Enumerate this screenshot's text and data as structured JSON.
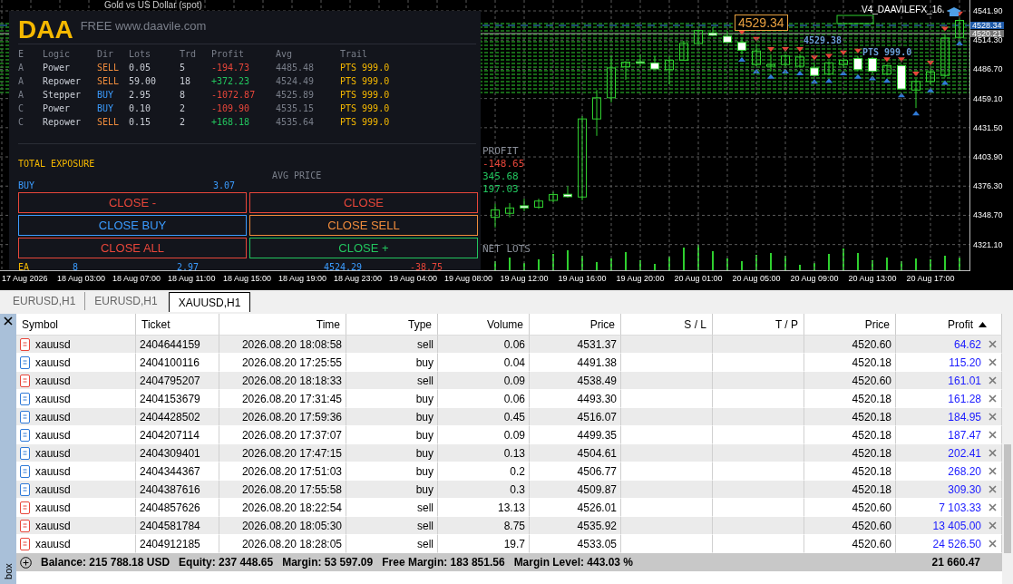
{
  "chart": {
    "title": "Gold vs US Dollar (spot)",
    "expert_label": "V4_DAAVILEFX_16.",
    "level_label": "4529.34",
    "avg_label": "4529.38",
    "trail_label": "PTS 999.0",
    "chart_data": {
      "type": "candlestick",
      "categories": [
        null,
        null,
        "19 Aug 12:00",
        null,
        null,
        null,
        "19 Aug 16:00",
        null,
        null,
        null,
        "19 Aug 20:00",
        null,
        null,
        null,
        "20 Aug 01:00",
        null,
        null,
        null,
        "20 Aug 05:00",
        null,
        null,
        null,
        "20 Aug 09:00",
        null,
        null,
        null,
        "20 Aug 13:00",
        null,
        null,
        null,
        "20 Aug 17:00",
        null,
        null
      ],
      "ohlc": [
        [
          4346.8,
          4359.6,
          4337.1,
          4353.8
        ],
        [
          4350.6,
          4360.2,
          4346.8,
          4355.7
        ],
        [
          4357.7,
          4364.4,
          4352.5,
          4355.7
        ],
        [
          4356.4,
          4364.4,
          4354.8,
          4362.2
        ],
        [
          4362.8,
          4370.8,
          4361.2,
          4368.3
        ],
        [
          4368.6,
          4376.3,
          4365.4,
          4366.3
        ],
        [
          4366.0,
          4442.4,
          4362.8,
          4439.8
        ],
        [
          4439.8,
          4467.1,
          4423.8,
          4459.8
        ],
        [
          4459.8,
          4499.2,
          4455.3,
          4488.0
        ],
        [
          4489.0,
          4494.4,
          4476.8,
          4493.5
        ],
        [
          4493.8,
          4500.8,
          4489.6,
          4492.5
        ],
        [
          4492.8,
          4499.2,
          4486.4,
          4487.0
        ],
        [
          4486.4,
          4499.2,
          4472.6,
          4495.1
        ],
        [
          4495.1,
          4513.7,
          4495.1,
          4511.1
        ],
        [
          4511.1,
          4524.0,
          4510.5,
          4523.3
        ],
        [
          4521.1,
          4526.5,
          4518.2,
          4518.8
        ],
        [
          4517.9,
          4523.3,
          4511.4,
          4512.1
        ],
        [
          4512.1,
          4516.9,
          4500.8,
          4504.7
        ],
        [
          4491.2,
          4510.5,
          4489.6,
          4504.0
        ],
        [
          4489.6,
          4500.8,
          4484.8,
          4491.2
        ],
        [
          4491.2,
          4500.8,
          4489.6,
          4499.2
        ],
        [
          4489.6,
          4500.8,
          4488.0,
          4498.3
        ],
        [
          4488.0,
          4492.8,
          4480.0,
          4480.9
        ],
        [
          4482.2,
          4494.4,
          4480.9,
          4492.8
        ],
        [
          4491.2,
          4497.6,
          4488.0,
          4495.1
        ],
        [
          4497.0,
          4499.2,
          4484.8,
          4486.4
        ],
        [
          4497.0,
          4499.2,
          4483.2,
          4484.8
        ],
        [
          4482.2,
          4491.2,
          4480.9,
          4490.2
        ],
        [
          4490.2,
          4491.2,
          4467.1,
          4468.1
        ],
        [
          4467.1,
          4477.7,
          4450.1,
          4475.2
        ],
        [
          4475.2,
          4488.0,
          4471.9,
          4484.1
        ],
        [
          4480.9,
          4520.1,
          4479.0,
          4516.2
        ],
        [
          4516.9,
          4534.5,
          4516.2,
          4532.9
        ]
      ],
      "ylim": [
        4296.8,
        4552.2
      ],
      "grid": true,
      "yticks": [
        {
          "value": 4541.9,
          "label": "4541.90"
        },
        {
          "value": 4514.3,
          "label": "4514.30"
        },
        {
          "value": 4486.7,
          "label": "4486.70"
        },
        {
          "value": 4459.1,
          "label": "4459.10"
        },
        {
          "value": 4431.5,
          "label": "4431.50"
        },
        {
          "value": 4403.9,
          "label": "4403.90"
        },
        {
          "value": 4376.3,
          "label": "4376.30"
        },
        {
          "value": 4348.7,
          "label": "4348.70"
        },
        {
          "value": 4321.1,
          "label": "4321.10"
        }
      ]
    },
    "ask_label": "4528.34",
    "bid_label": "4520.21",
    "time_labels": [
      "17 Aug 2026",
      "18 Aug 03:00",
      "18 Aug 07:00",
      "18 Aug 11:00",
      "18 Aug 15:00",
      "18 Aug 19:00",
      "18 Aug 23:00",
      "19 Aug 04:00",
      "19 Aug 08:00"
    ],
    "side_profits": [
      {
        "text": "PROFIT",
        "color": "#8a8f99"
      },
      {
        "text": "-148.65",
        "color": "#e8463a"
      },
      {
        "text": "345.68",
        "color": "#22c55e"
      },
      {
        "text": "197.03",
        "color": "#22c55e"
      },
      {
        "text": "NET LOTS",
        "color": "#8a8f99"
      }
    ]
  },
  "panel": {
    "logo": "DAA",
    "website": "FREE www.daavile.com",
    "columns": [
      "E",
      "Logic",
      "Dir",
      "Lots",
      "Trd",
      "Profit",
      "Avg",
      "Trail"
    ],
    "rows": [
      {
        "e": "A",
        "logic": "Power",
        "dir": {
          "text": "SELL",
          "color": "#f08c3c"
        },
        "lots": "0.05",
        "trd": "5",
        "profit": {
          "text": "-194.73",
          "color": "#e8463a"
        },
        "avg": "4485.48",
        "trail": "PTS 999.0"
      },
      {
        "e": "A",
        "logic": "Repower",
        "dir": {
          "text": "SELL",
          "color": "#f08c3c"
        },
        "lots": "59.00",
        "trd": "18",
        "profit": {
          "text": "+372.23",
          "color": "#22c55e"
        },
        "avg": "4524.49",
        "trail": "PTS 999.0"
      },
      {
        "e": "A",
        "logic": "Stepper",
        "dir": {
          "text": "BUY",
          "color": "#3b9cff"
        },
        "lots": "2.95",
        "trd": "8",
        "profit": {
          "text": "-1072.87",
          "color": "#e8463a"
        },
        "avg": "4525.89",
        "trail": "PTS 999.0"
      },
      {
        "e": "C",
        "logic": "Power",
        "dir": {
          "text": "BUY",
          "color": "#3b9cff"
        },
        "lots": "0.10",
        "trd": "2",
        "profit": {
          "text": "-109.90",
          "color": "#e8463a"
        },
        "avg": "4535.15",
        "trail": "PTS 999.0"
      },
      {
        "e": "C",
        "logic": "Repower",
        "dir": {
          "text": "SELL",
          "color": "#f08c3c"
        },
        "lots": "0.15",
        "trd": "2",
        "profit": {
          "text": "+168.18",
          "color": "#22c55e"
        },
        "avg": "4535.64",
        "trail": "PTS 999.0"
      }
    ],
    "exposure_title": "TOTAL EXPOSURE",
    "avg_header": "AVG PRICE",
    "buy_label": "BUY",
    "buy_lots": "3.07",
    "buttons": [
      {
        "label": "CLOSE -",
        "color": "#e8463a"
      },
      {
        "label": "CLOSE",
        "color": "#e8463a"
      },
      {
        "label": "CLOSE BUY",
        "color": "#3b9cff"
      },
      {
        "label": "CLOSE SELL",
        "color": "#f08c3c"
      },
      {
        "label": "CLOSE ALL",
        "color": "#e8463a"
      },
      {
        "label": "CLOSE +",
        "color": "#22c55e"
      }
    ],
    "footer": [
      {
        "text": "EA",
        "color": "#f5b800"
      },
      {
        "text": "8",
        "color": "#3b9cff"
      },
      {
        "text": "2.97",
        "color": "#3b9cff"
      },
      {
        "text": "4524.29",
        "color": "#3b9cff"
      },
      {
        "text": "-38.75",
        "color": "#e8463a"
      }
    ]
  },
  "tabs": [
    {
      "label": "EURUSD,H1",
      "selected": false
    },
    {
      "label": "EURUSD,H1",
      "selected": false
    },
    {
      "label": "XAUUSD,H1",
      "selected": true
    }
  ],
  "table": {
    "columns": [
      {
        "label": "Symbol",
        "sorted": false
      },
      {
        "label": "Ticket",
        "sorted": false
      },
      {
        "label": "Time",
        "sorted": false
      },
      {
        "label": "Type",
        "sorted": false
      },
      {
        "label": "Volume",
        "sorted": false
      },
      {
        "label": "Price",
        "sorted": false
      },
      {
        "label": "S / L",
        "sorted": false
      },
      {
        "label": "T / P",
        "sorted": false
      },
      {
        "label": "Price",
        "sorted": false
      },
      {
        "label": "Profit",
        "sorted": true
      }
    ],
    "rows": [
      {
        "kind": "sell",
        "symbol": "xauusd",
        "ticket": "2404644159",
        "time": "2026.08.20 18:08:58",
        "type": "sell",
        "volume": "0.06",
        "price": "4531.37",
        "current_price": "4520.60",
        "profit": "64.62"
      },
      {
        "kind": "buy",
        "symbol": "xauusd",
        "ticket": "2404100116",
        "time": "2026.08.20 17:25:55",
        "type": "buy",
        "volume": "0.04",
        "price": "4491.38",
        "current_price": "4520.18",
        "profit": "115.20"
      },
      {
        "kind": "sell",
        "symbol": "xauusd",
        "ticket": "2404795207",
        "time": "2026.08.20 18:18:33",
        "type": "sell",
        "volume": "0.09",
        "price": "4538.49",
        "current_price": "4520.60",
        "profit": "161.01"
      },
      {
        "kind": "buy",
        "symbol": "xauusd",
        "ticket": "2404153679",
        "time": "2026.08.20 17:31:45",
        "type": "buy",
        "volume": "0.06",
        "price": "4493.30",
        "current_price": "4520.18",
        "profit": "161.28"
      },
      {
        "kind": "buy",
        "symbol": "xauusd",
        "ticket": "2404428502",
        "time": "2026.08.20 17:59:36",
        "type": "buy",
        "volume": "0.45",
        "price": "4516.07",
        "current_price": "4520.18",
        "profit": "184.95"
      },
      {
        "kind": "buy",
        "symbol": "xauusd",
        "ticket": "2404207114",
        "time": "2026.08.20 17:37:07",
        "type": "buy",
        "volume": "0.09",
        "price": "4499.35",
        "current_price": "4520.18",
        "profit": "187.47"
      },
      {
        "kind": "buy",
        "symbol": "xauusd",
        "ticket": "2404309401",
        "time": "2026.08.20 17:47:15",
        "type": "buy",
        "volume": "0.13",
        "price": "4504.61",
        "current_price": "4520.18",
        "profit": "202.41"
      },
      {
        "kind": "buy",
        "symbol": "xauusd",
        "ticket": "2404344367",
        "time": "2026.08.20 17:51:03",
        "type": "buy",
        "volume": "0.2",
        "price": "4506.77",
        "current_price": "4520.18",
        "profit": "268.20"
      },
      {
        "kind": "buy",
        "symbol": "xauusd",
        "ticket": "2404387616",
        "time": "2026.08.20 17:55:58",
        "type": "buy",
        "volume": "0.3",
        "price": "4509.87",
        "current_price": "4520.18",
        "profit": "309.30"
      },
      {
        "kind": "sell",
        "symbol": "xauusd",
        "ticket": "2404857626",
        "time": "2026.08.20 18:22:54",
        "type": "sell",
        "volume": "13.13",
        "price": "4526.01",
        "current_price": "4520.60",
        "profit": "7 103.33"
      },
      {
        "kind": "sell",
        "symbol": "xauusd",
        "ticket": "2404581784",
        "time": "2026.08.20 18:05:30",
        "type": "sell",
        "volume": "8.75",
        "price": "4535.92",
        "current_price": "4520.60",
        "profit": "13 405.00"
      },
      {
        "kind": "sell",
        "symbol": "xauusd",
        "ticket": "2404912185",
        "time": "2026.08.20 18:28:05",
        "type": "sell",
        "volume": "19.7",
        "price": "4533.05",
        "current_price": "4520.60",
        "profit": "24 526.50"
      }
    ],
    "summary": [
      "Balance: 215 788.18 USD",
      "Equity: 237 448.65",
      "Margin: 53 597.09",
      "Free Margin: 183 851.56",
      "Margin Level: 443.03 %"
    ],
    "total_profit": "21 660.47"
  },
  "side_label": "box"
}
